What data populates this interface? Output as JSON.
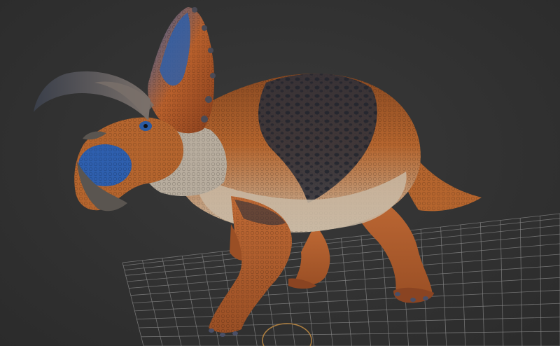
{
  "viewport": {
    "background_color": "#333333",
    "grid_color": "#8a8a8a",
    "gizmo_color": "#b08040",
    "model": {
      "subject_icon": "triceratops-icon",
      "skin_colors": {
        "body_orange": "#b5652e",
        "belly_cream": "#c9b9a3",
        "back_dark": "#2c2f3a",
        "frill_blue": "#2f5fa8",
        "horn_grey": "#5a5550",
        "face_blue": "#2e5fae"
      }
    }
  }
}
